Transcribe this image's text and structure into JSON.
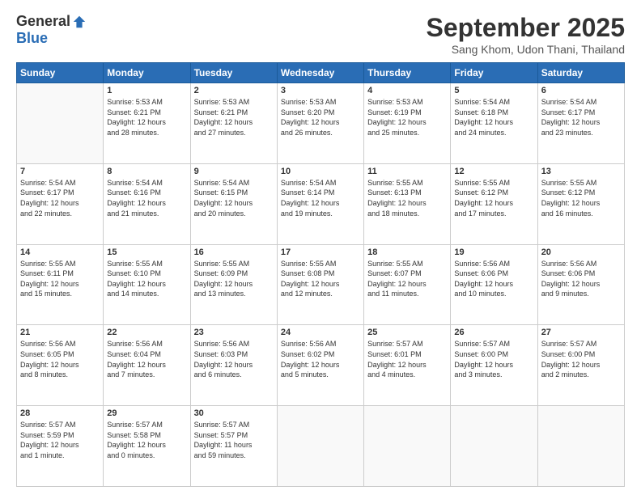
{
  "header": {
    "logo_general": "General",
    "logo_blue": "Blue",
    "month_title": "September 2025",
    "subtitle": "Sang Khom, Udon Thani, Thailand"
  },
  "days_of_week": [
    "Sunday",
    "Monday",
    "Tuesday",
    "Wednesday",
    "Thursday",
    "Friday",
    "Saturday"
  ],
  "weeks": [
    [
      {
        "day": "",
        "info": ""
      },
      {
        "day": "1",
        "info": "Sunrise: 5:53 AM\nSunset: 6:21 PM\nDaylight: 12 hours\nand 28 minutes."
      },
      {
        "day": "2",
        "info": "Sunrise: 5:53 AM\nSunset: 6:21 PM\nDaylight: 12 hours\nand 27 minutes."
      },
      {
        "day": "3",
        "info": "Sunrise: 5:53 AM\nSunset: 6:20 PM\nDaylight: 12 hours\nand 26 minutes."
      },
      {
        "day": "4",
        "info": "Sunrise: 5:53 AM\nSunset: 6:19 PM\nDaylight: 12 hours\nand 25 minutes."
      },
      {
        "day": "5",
        "info": "Sunrise: 5:54 AM\nSunset: 6:18 PM\nDaylight: 12 hours\nand 24 minutes."
      },
      {
        "day": "6",
        "info": "Sunrise: 5:54 AM\nSunset: 6:17 PM\nDaylight: 12 hours\nand 23 minutes."
      }
    ],
    [
      {
        "day": "7",
        "info": "Sunrise: 5:54 AM\nSunset: 6:17 PM\nDaylight: 12 hours\nand 22 minutes."
      },
      {
        "day": "8",
        "info": "Sunrise: 5:54 AM\nSunset: 6:16 PM\nDaylight: 12 hours\nand 21 minutes."
      },
      {
        "day": "9",
        "info": "Sunrise: 5:54 AM\nSunset: 6:15 PM\nDaylight: 12 hours\nand 20 minutes."
      },
      {
        "day": "10",
        "info": "Sunrise: 5:54 AM\nSunset: 6:14 PM\nDaylight: 12 hours\nand 19 minutes."
      },
      {
        "day": "11",
        "info": "Sunrise: 5:55 AM\nSunset: 6:13 PM\nDaylight: 12 hours\nand 18 minutes."
      },
      {
        "day": "12",
        "info": "Sunrise: 5:55 AM\nSunset: 6:12 PM\nDaylight: 12 hours\nand 17 minutes."
      },
      {
        "day": "13",
        "info": "Sunrise: 5:55 AM\nSunset: 6:12 PM\nDaylight: 12 hours\nand 16 minutes."
      }
    ],
    [
      {
        "day": "14",
        "info": "Sunrise: 5:55 AM\nSunset: 6:11 PM\nDaylight: 12 hours\nand 15 minutes."
      },
      {
        "day": "15",
        "info": "Sunrise: 5:55 AM\nSunset: 6:10 PM\nDaylight: 12 hours\nand 14 minutes."
      },
      {
        "day": "16",
        "info": "Sunrise: 5:55 AM\nSunset: 6:09 PM\nDaylight: 12 hours\nand 13 minutes."
      },
      {
        "day": "17",
        "info": "Sunrise: 5:55 AM\nSunset: 6:08 PM\nDaylight: 12 hours\nand 12 minutes."
      },
      {
        "day": "18",
        "info": "Sunrise: 5:55 AM\nSunset: 6:07 PM\nDaylight: 12 hours\nand 11 minutes."
      },
      {
        "day": "19",
        "info": "Sunrise: 5:56 AM\nSunset: 6:06 PM\nDaylight: 12 hours\nand 10 minutes."
      },
      {
        "day": "20",
        "info": "Sunrise: 5:56 AM\nSunset: 6:06 PM\nDaylight: 12 hours\nand 9 minutes."
      }
    ],
    [
      {
        "day": "21",
        "info": "Sunrise: 5:56 AM\nSunset: 6:05 PM\nDaylight: 12 hours\nand 8 minutes."
      },
      {
        "day": "22",
        "info": "Sunrise: 5:56 AM\nSunset: 6:04 PM\nDaylight: 12 hours\nand 7 minutes."
      },
      {
        "day": "23",
        "info": "Sunrise: 5:56 AM\nSunset: 6:03 PM\nDaylight: 12 hours\nand 6 minutes."
      },
      {
        "day": "24",
        "info": "Sunrise: 5:56 AM\nSunset: 6:02 PM\nDaylight: 12 hours\nand 5 minutes."
      },
      {
        "day": "25",
        "info": "Sunrise: 5:57 AM\nSunset: 6:01 PM\nDaylight: 12 hours\nand 4 minutes."
      },
      {
        "day": "26",
        "info": "Sunrise: 5:57 AM\nSunset: 6:00 PM\nDaylight: 12 hours\nand 3 minutes."
      },
      {
        "day": "27",
        "info": "Sunrise: 5:57 AM\nSunset: 6:00 PM\nDaylight: 12 hours\nand 2 minutes."
      }
    ],
    [
      {
        "day": "28",
        "info": "Sunrise: 5:57 AM\nSunset: 5:59 PM\nDaylight: 12 hours\nand 1 minute."
      },
      {
        "day": "29",
        "info": "Sunrise: 5:57 AM\nSunset: 5:58 PM\nDaylight: 12 hours\nand 0 minutes."
      },
      {
        "day": "30",
        "info": "Sunrise: 5:57 AM\nSunset: 5:57 PM\nDaylight: 11 hours\nand 59 minutes."
      },
      {
        "day": "",
        "info": ""
      },
      {
        "day": "",
        "info": ""
      },
      {
        "day": "",
        "info": ""
      },
      {
        "day": "",
        "info": ""
      }
    ]
  ]
}
